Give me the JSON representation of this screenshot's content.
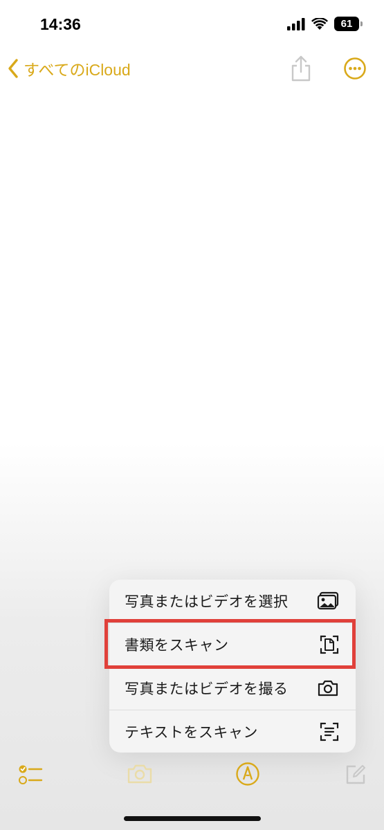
{
  "status_bar": {
    "time": "14:36",
    "battery_level": "61",
    "icons": [
      "cellular-signal-icon",
      "wifi-icon",
      "battery-icon"
    ]
  },
  "nav": {
    "back_label": "すべてのiCloud",
    "accent_color": "#d9a91a",
    "icons": [
      "chevron-left-icon",
      "share-icon",
      "more-icon"
    ]
  },
  "menu": {
    "items": [
      {
        "label": "写真またはビデオを選択",
        "icon": "photo-library-icon"
      },
      {
        "label": "書類をスキャン",
        "icon": "document-scan-icon",
        "highlighted": true
      },
      {
        "label": "写真またはビデオを撮る",
        "icon": "camera-icon"
      },
      {
        "label": "テキストをスキャン",
        "icon": "text-scan-icon"
      }
    ],
    "highlight_color": "#e0403a"
  },
  "toolbar": {
    "icons": [
      "checklist-icon",
      "camera-icon",
      "markup-icon",
      "compose-icon"
    ]
  }
}
